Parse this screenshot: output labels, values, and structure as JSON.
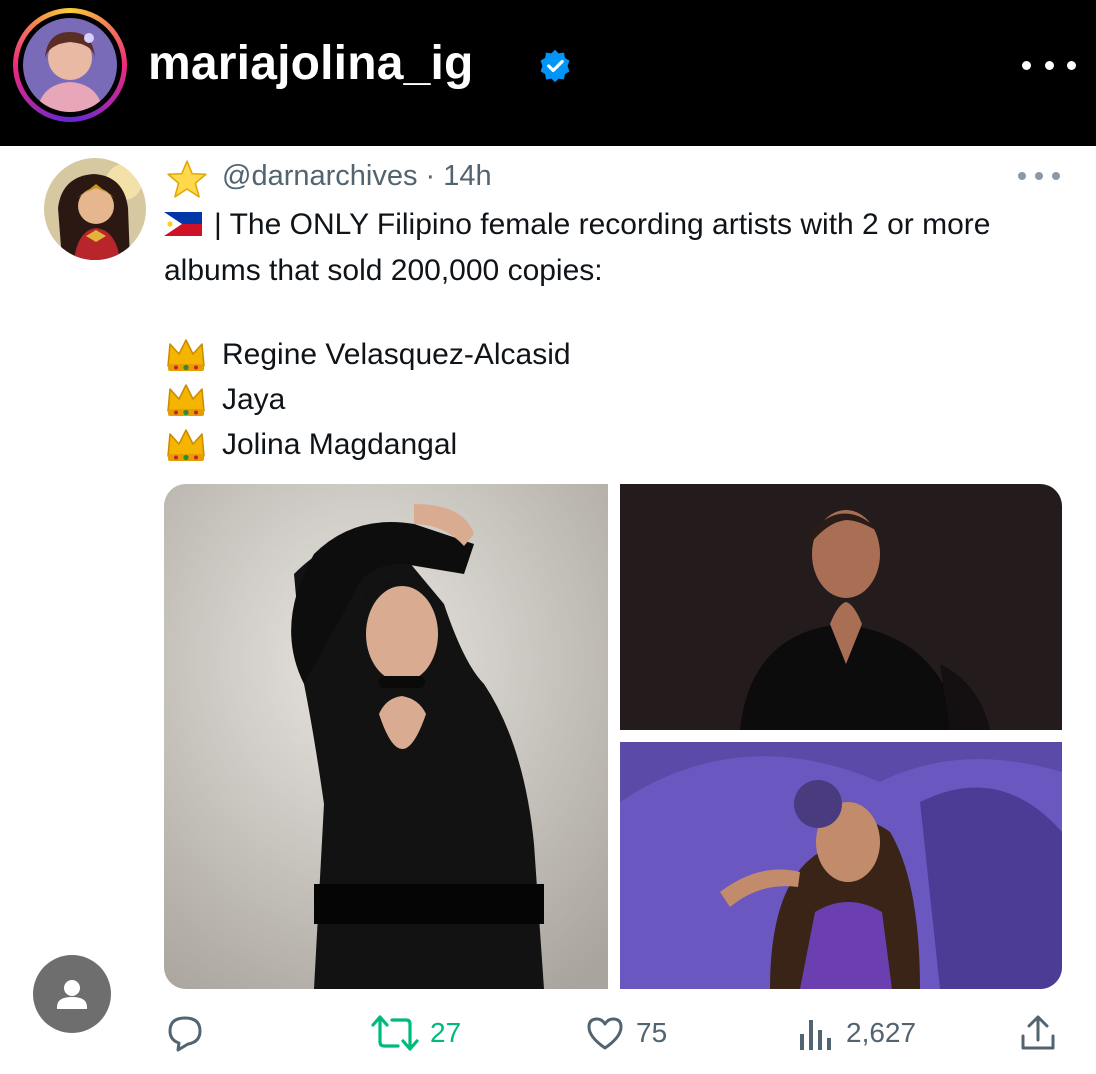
{
  "instagram": {
    "username": "mariajolina_ig",
    "verified_icon": "verified-badge-icon",
    "more_icon": "more-horizontal-icon"
  },
  "tweet": {
    "handle": "@darnarchives",
    "separator": " · ",
    "time": "14h",
    "text": "| The ONLY Filipino female recording artists with 2 or more albums that sold 200,000 copies:",
    "artists": [
      "Regine Velasquez-Alcasid",
      "Jaya",
      "Jolina Magdangal"
    ],
    "stats": {
      "retweets": "27",
      "likes": "75",
      "views": "2,627"
    }
  },
  "colors": {
    "header_bg": "#000000",
    "verified": "#0095f6",
    "retweet_green": "#00ba7c",
    "muted_text": "#536471"
  }
}
